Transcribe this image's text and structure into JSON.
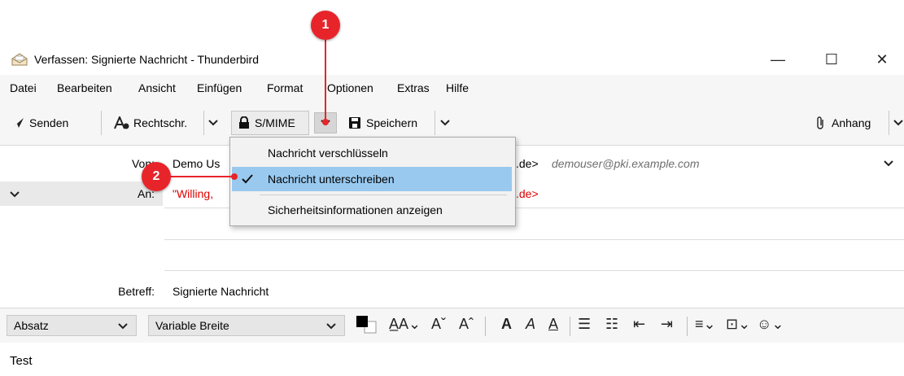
{
  "window": {
    "title": "Verfassen: Signierte Nachricht - Thunderbird",
    "minimize": "—",
    "maximize": "☐",
    "close": "✕"
  },
  "menu": [
    "Datei",
    "Bearbeiten",
    "Ansicht",
    "Einfügen",
    "Format",
    "Optionen",
    "Extras",
    "Hilfe"
  ],
  "toolbar": {
    "send": "Senden",
    "spell": "Rechtschr.",
    "smime": "S/MIME",
    "save": "Speichern",
    "attach": "Anhang"
  },
  "header": {
    "from_label": "Von:",
    "from_value_name": "Demo Us",
    "from_value_tail": ".de>",
    "from_identity": "demouser@pki.example.com",
    "to_label": "An:",
    "to_value": "\"Willing,",
    "to_value_tail": ".de>",
    "subject_label": "Betreff:",
    "subject_value": "Signierte Nachricht"
  },
  "format": {
    "paragraph": "Absatz",
    "font": "Variable Breite"
  },
  "dropdown": {
    "items": [
      "Nachricht verschlüsseln",
      "Nachricht unterschreiben",
      "Sicherheitsinformationen anzeigen"
    ],
    "checked_item": "Nachricht unterschreiben"
  },
  "body": {
    "text": "Test"
  },
  "callouts": [
    "1",
    "2"
  ],
  "colors": {
    "callout": "#e8242b",
    "recipient": "#e00000",
    "highlight": "#99c9ef"
  }
}
